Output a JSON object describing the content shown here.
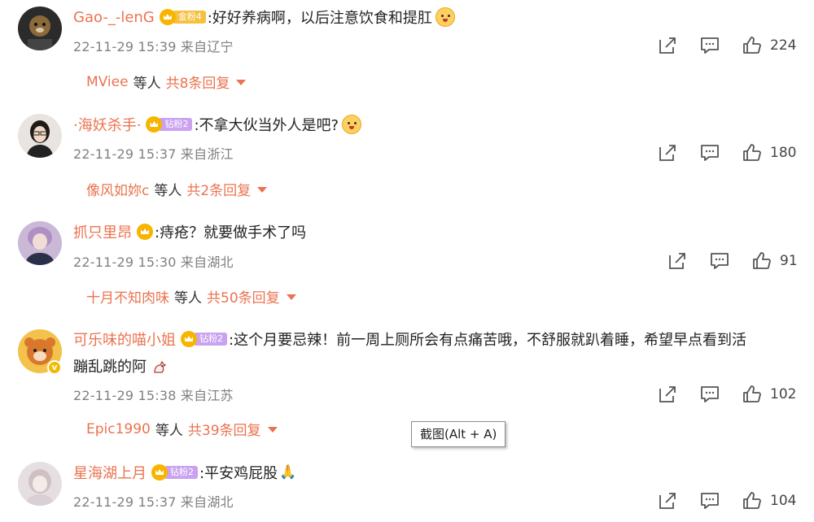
{
  "comments": [
    {
      "username": "Gao-_-lenG",
      "fan_badge": "金粉4",
      "text": ":好好养病啊，以后注意饮食和提肛",
      "time": "22-11-29 15:39",
      "location": "来自辽宁",
      "likes": "224",
      "reply_preview": {
        "name": "MViee",
        "mid": "等人",
        "total": "共8条回复"
      }
    },
    {
      "username": "·海妖杀手·",
      "fan_badge": "钻粉2",
      "text": ":不拿大伙当外人是吧?",
      "time": "22-11-29 15:37",
      "location": "来自浙江",
      "likes": "180",
      "reply_preview": {
        "name": "像风如妳c",
        "mid": "等人",
        "total": "共2条回复"
      }
    },
    {
      "username": "抓只里昂",
      "fan_badge": "",
      "text": ":痔疮？就要做手术了吗",
      "time": "22-11-29 15:30",
      "location": "来自湖北",
      "likes": "91",
      "reply_preview": {
        "name": "十月不知肉味",
        "mid": "等人",
        "total": "共50条回复"
      }
    },
    {
      "username": "可乐味的喵小姐",
      "fan_badge": "钻粉2",
      "text": ":这个月要忌辣！前一周上厕所会有点痛苦哦，不舒服就趴着睡，希望早点看到活",
      "text_line2": "蹦乱跳的阿",
      "time": "22-11-29 15:38",
      "location": "来自江苏",
      "likes": "102",
      "reply_preview": {
        "name": "Epic1990",
        "mid": "等人",
        "total": "共39条回复"
      }
    },
    {
      "username": "星海湖上月",
      "fan_badge": "钻粉2",
      "text": ":平安鸡屁股",
      "time": "22-11-29 15:37",
      "location": "来自湖北",
      "likes": "104"
    }
  ],
  "tooltip": "截图(Alt + A)",
  "icons": [
    "share-icon",
    "comment-icon",
    "like-icon"
  ],
  "colors": {
    "username": "#eb7350",
    "meta": "#808080",
    "accent_gold": "#f6c141",
    "accent_purple": "#c9a2f0"
  }
}
